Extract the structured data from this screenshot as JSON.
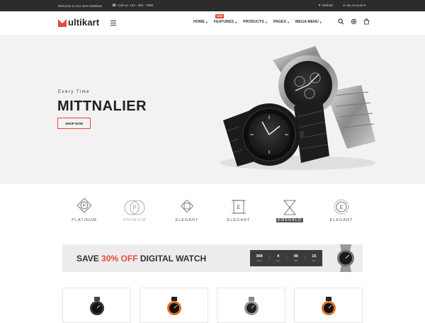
{
  "topbar": {
    "welcome": "Welcome to Our store Multikart",
    "phone": "Call Us: 123 - 456 - 7890",
    "wishlist": "Wishlist",
    "account": "My Account"
  },
  "brand": {
    "logo_letter": "M",
    "logo_rest": "ultikart",
    "accent": "#e8493a"
  },
  "nav": {
    "items": [
      {
        "label": "HOME"
      },
      {
        "label": "FEATURES",
        "badge": "NEW"
      },
      {
        "label": "PRODUCTS"
      },
      {
        "label": "PAGES"
      },
      {
        "label": "MEGA MENU"
      }
    ]
  },
  "hero": {
    "eyebrow": "Every Time",
    "title": "MITTNALIER",
    "cta": "SHOP NOW",
    "bg": "#f3f1f1"
  },
  "brands": [
    {
      "name": "PLATINUM"
    },
    {
      "name": "PREMIUM"
    },
    {
      "name": "ELEGANT"
    },
    {
      "name": "ELEGANT"
    },
    {
      "name": "EMERALD"
    },
    {
      "name": "ELEGANT"
    }
  ],
  "promo": {
    "prefix": "SAVE",
    "highlight": "30% OFF",
    "suffix": "DIGITAL WATCH",
    "timer": {
      "days": "308",
      "days_label": "Days",
      "hours": "4",
      "hours_label": "Hrs",
      "minutes": "49",
      "minutes_label": "Min",
      "seconds": "15",
      "seconds_label": "Sec"
    }
  },
  "icons": {
    "search": "search-icon",
    "settings": "gear-icon",
    "cart": "cart-icon",
    "menu": "hamburger-icon",
    "wishlist": "heart-icon",
    "account": "user-icon",
    "phone": "phone-icon"
  }
}
